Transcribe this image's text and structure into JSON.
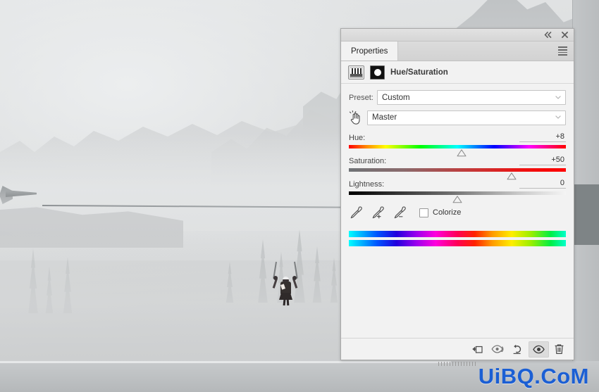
{
  "app": {
    "watermark": "UiBQ.CoM"
  },
  "photo": {
    "description": "misty mountain zipline scene",
    "subject": "zipline-rider",
    "cable": "zipline-cable",
    "tower": "zipline-tower"
  },
  "panel": {
    "titlebar": {
      "collapse_icon": "double-chevron-left-icon",
      "close_icon": "close-icon"
    },
    "tabs": [
      {
        "label": "Properties",
        "active": true
      }
    ],
    "menu_icon": "panel-menu-icon",
    "adjustment": {
      "title": "Hue/Saturation",
      "adjustment_icon": "hue-saturation-adjustment-icon",
      "mask_icon": "layer-mask-thumbnail-icon"
    },
    "preset": {
      "label": "Preset:",
      "value": "Custom",
      "chevron_icon": "chevron-down-icon"
    },
    "channel": {
      "tool_icon": "on-image-adjustment-hand-icon",
      "value": "Master",
      "chevron_icon": "chevron-down-icon"
    },
    "sliders": [
      {
        "name": "Hue:",
        "value": "+8",
        "percent": 52
      },
      {
        "name": "Saturation:",
        "value": "+50",
        "percent": 75
      },
      {
        "name": "Lightness:",
        "value": "0",
        "percent": 50
      }
    ],
    "eyedroppers": [
      {
        "icon": "eyedropper-icon"
      },
      {
        "icon": "eyedropper-add-icon"
      },
      {
        "icon": "eyedropper-subtract-icon"
      }
    ],
    "colorize": {
      "label": "Colorize",
      "checked": false
    },
    "hue_bars": [
      {
        "name": "source-hue-bar"
      },
      {
        "name": "result-hue-bar"
      }
    ],
    "footer_buttons": [
      {
        "name": "clip-to-layer-button",
        "icon": "clip-to-layer-icon",
        "active": false
      },
      {
        "name": "toggle-previous-state-button",
        "icon": "eye-previous-icon",
        "active": false
      },
      {
        "name": "reset-button",
        "icon": "reset-arrow-icon",
        "active": false
      },
      {
        "name": "toggle-visibility-button",
        "icon": "eye-icon",
        "active": true
      },
      {
        "name": "delete-button",
        "icon": "trash-icon",
        "active": false
      }
    ]
  }
}
